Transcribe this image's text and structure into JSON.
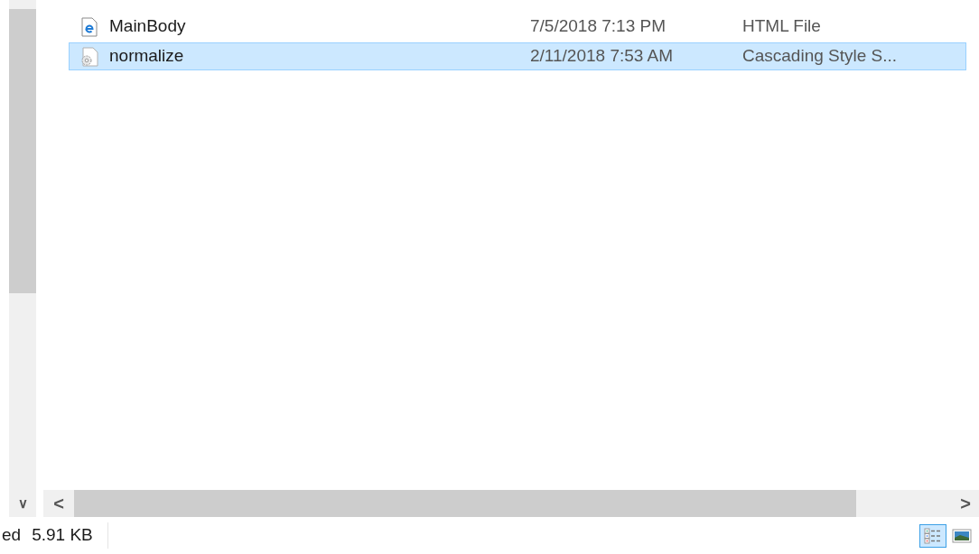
{
  "files": [
    {
      "kind": "html",
      "name": "MainBody",
      "date": "7/5/2018 7:13 PM",
      "type": "HTML File",
      "selected": false
    },
    {
      "kind": "css",
      "name": "normalize",
      "date": "2/11/2018 7:53 AM",
      "type": "Cascading Style S...",
      "selected": true
    }
  ],
  "scroll": {
    "up_glyph": "∨",
    "left_glyph": "<",
    "right_glyph": ">"
  },
  "status_bar": {
    "selection_text": "ed",
    "size": "5.91 KB"
  },
  "views": [
    {
      "kind": "details",
      "selected": true
    },
    {
      "kind": "large-icons",
      "selected": false
    }
  ]
}
